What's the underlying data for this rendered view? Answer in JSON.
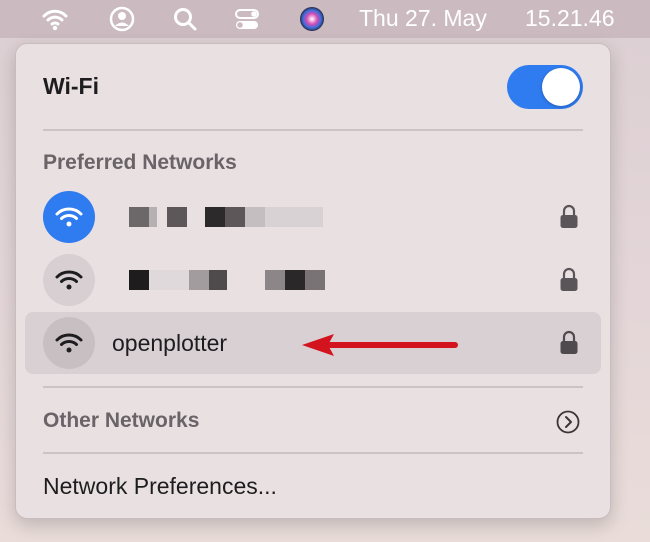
{
  "menubar": {
    "date": "Thu 27. May",
    "time": "15.21.46",
    "icons": [
      "wifi-icon",
      "user-icon",
      "search-icon",
      "control-center-icon",
      "siri-icon"
    ]
  },
  "wifi_panel": {
    "title": "Wi-Fi",
    "toggle_on": true,
    "preferred_title": "Preferred Networks",
    "networks": [
      {
        "name": "",
        "connected": true,
        "secured": true
      },
      {
        "name": "",
        "connected": false,
        "secured": true
      },
      {
        "name": "openplotter",
        "connected": false,
        "secured": true
      }
    ],
    "other_networks": "Other Networks",
    "network_preferences": "Network Preferences..."
  },
  "colors": {
    "accent": "#2f7bf0",
    "arrow": "#d3141e",
    "panel_bg": "#e9e0e2"
  }
}
